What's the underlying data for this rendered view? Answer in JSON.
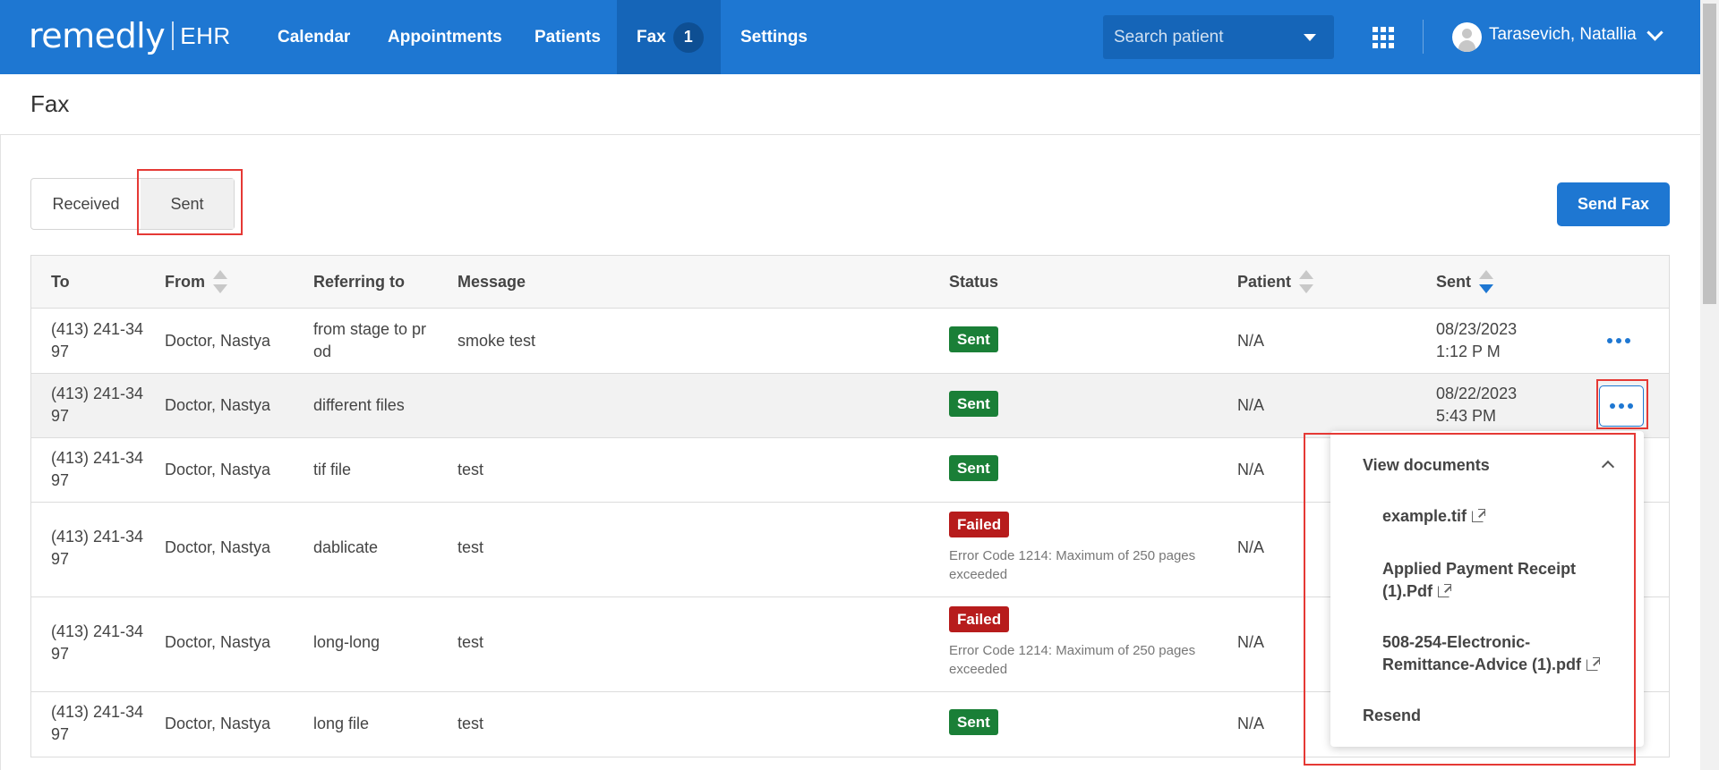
{
  "brand": {
    "name": "remedly",
    "product": "EHR"
  },
  "nav": {
    "calendar": "Calendar",
    "appointments": "Appointments",
    "patients": "Patients",
    "fax": "Fax",
    "fax_badge": "1",
    "settings": "Settings",
    "search_placeholder": "Search patient",
    "user_name": "Tarasevich, Natallia"
  },
  "page": {
    "title": "Fax"
  },
  "tabs": {
    "received": "Received",
    "sent": "Sent"
  },
  "send_fax_button": "Send Fax",
  "table": {
    "columns": {
      "to": "To",
      "from": "From",
      "referring": "Referring to",
      "message": "Message",
      "status": "Status",
      "patient": "Patient",
      "sent": "Sent"
    },
    "rows": [
      {
        "to": "(413) 241-34 97",
        "from": "Doctor, Nastya",
        "referring": "from stage to pr od",
        "message": "smoke test",
        "status": "Sent",
        "error": "",
        "patient": "N/A",
        "sent": "08/23/2023 1:12 P M"
      },
      {
        "to": "(413) 241-34 97",
        "from": "Doctor, Nastya",
        "referring": "different files",
        "message": "",
        "status": "Sent",
        "error": "",
        "patient": "N/A",
        "sent": "08/22/2023 5:43 PM"
      },
      {
        "to": "(413) 241-34 97",
        "from": "Doctor, Nastya",
        "referring": "tif file",
        "message": "test",
        "status": "Sent",
        "error": "",
        "patient": "N/A",
        "sent": ""
      },
      {
        "to": "(413) 241-34 97",
        "from": "Doctor, Nastya",
        "referring": "dablicate",
        "message": "test",
        "status": "Failed",
        "error": "Error Code 1214: Maximum of 250 pages exceeded",
        "patient": "N/A",
        "sent": ""
      },
      {
        "to": "(413) 241-34 97",
        "from": "Doctor, Nastya",
        "referring": "long-long",
        "message": "test",
        "status": "Failed",
        "error": "Error Code 1214: Maximum of 250 pages exceeded",
        "patient": "N/A",
        "sent": ""
      },
      {
        "to": "(413) 241-34 97",
        "from": "Doctor, Nastya",
        "referring": "long file",
        "message": "test",
        "status": "Sent",
        "error": "",
        "patient": "N/A",
        "sent": ""
      }
    ]
  },
  "dropdown": {
    "view_documents": "View documents",
    "documents": [
      "example.tif",
      "Applied Payment Receipt (1).Pdf",
      "508-254-Electronic-Remittance-Advice (1).pdf"
    ],
    "resend": "Resend"
  },
  "colors": {
    "primary": "#1e77d2",
    "sent_badge": "#1a7f37",
    "failed_badge": "#b71c1c",
    "highlight": "#e53935"
  },
  "icons": {
    "search_caret": "caret-down-icon",
    "apps": "grid-icon",
    "user": "avatar-icon",
    "user_menu": "chevron-down-icon",
    "row_menu": "more-horizontal-icon",
    "external": "external-link-icon",
    "collapse": "chevron-up-icon"
  }
}
